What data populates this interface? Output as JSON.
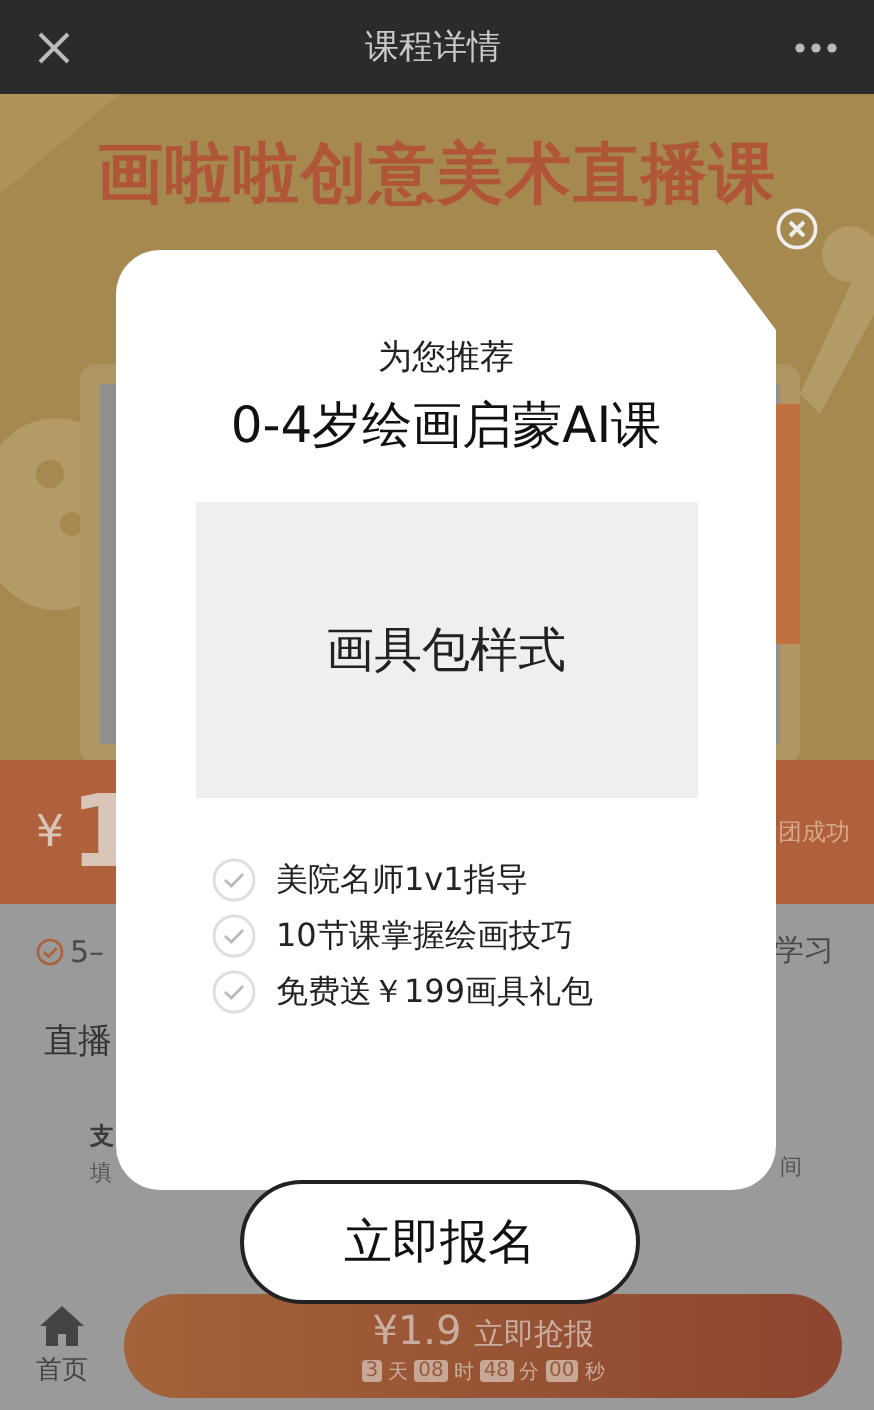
{
  "header": {
    "title": "课程详情"
  },
  "banner": {
    "title": "画啦啦创意美术直播课"
  },
  "price_band": {
    "currency": "¥",
    "amount": "1",
    "note": "团成功"
  },
  "features_row": {
    "left": "5–",
    "right": "学习"
  },
  "section": {
    "title": "直播"
  },
  "steps": [
    {
      "title": "支",
      "hint": "填"
    },
    {
      "hint": "间"
    }
  ],
  "tab_bar": {
    "home_label": "首页"
  },
  "cta": {
    "price": "¥1.9",
    "label": "立即抢报",
    "countdown": [
      {
        "value": "3",
        "unit": "天"
      },
      {
        "value": "08",
        "unit": "时"
      },
      {
        "value": "48",
        "unit": "分"
      },
      {
        "value": "00",
        "unit": "秒"
      }
    ]
  },
  "modal": {
    "subtitle": "为您推荐",
    "title": "0-4岁绘画启蒙AI课",
    "image_label": "画具包样式",
    "benefits": [
      "美院名师1v1指导",
      "10节课掌握绘画技巧",
      "免费送￥199画具礼包"
    ],
    "button": "立即报名"
  }
}
